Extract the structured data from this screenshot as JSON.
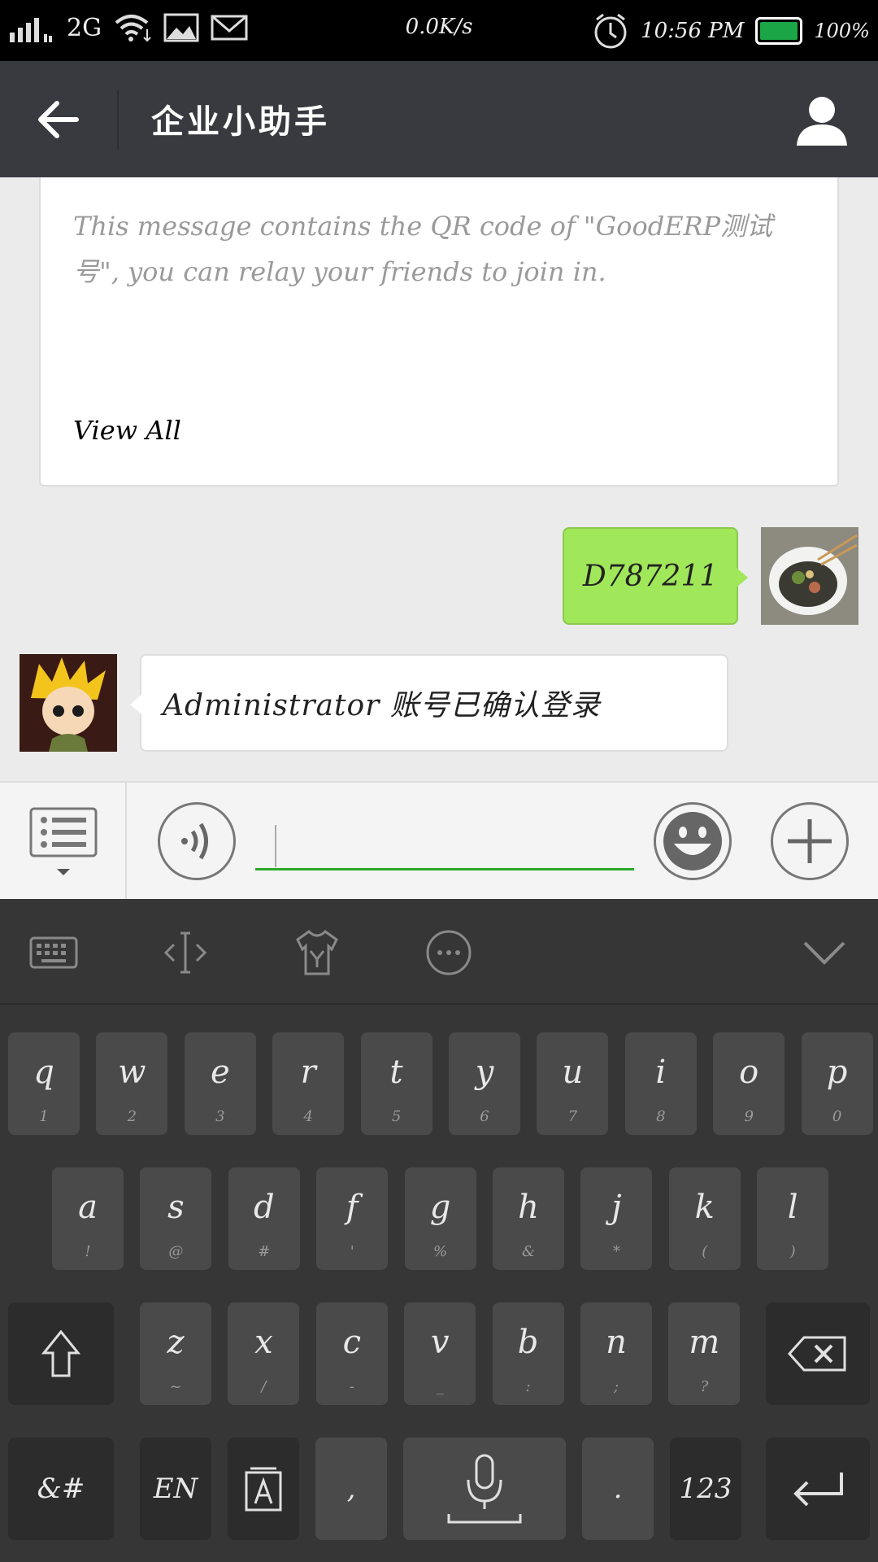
{
  "status_bar": {
    "network": "2G",
    "speed": "0.0K/s",
    "time": "10:56 PM",
    "battery": "100%",
    "battery_color": "#1aa547"
  },
  "header": {
    "title": "企业小助手",
    "back_icon": "arrow-left-icon",
    "profile_icon": "person-icon"
  },
  "messages": {
    "card": {
      "text": "This message contains the QR code of \"GoodERP测试号\", you can relay your friends to join in.",
      "link": "View All"
    },
    "outgoing": {
      "text": "D787211",
      "bubble_color": "#a0e75a"
    },
    "incoming": {
      "text": "Administrator 账号已确认登录"
    }
  },
  "input_bar": {
    "menu_icon": "list-menu-icon",
    "voice_icon": "voice-icon",
    "emoji_icon": "smiley-icon",
    "plus_icon": "plus-icon",
    "value": "",
    "accent": "#2ba82b"
  },
  "keyboard": {
    "toolbar": [
      "keyboard-icon",
      "cursor-move-icon",
      "theme-shirt-icon",
      "more-icon",
      "collapse-icon"
    ],
    "row1": [
      {
        "k": "q",
        "s": "1"
      },
      {
        "k": "w",
        "s": "2"
      },
      {
        "k": "e",
        "s": "3"
      },
      {
        "k": "r",
        "s": "4"
      },
      {
        "k": "t",
        "s": "5"
      },
      {
        "k": "y",
        "s": "6"
      },
      {
        "k": "u",
        "s": "7"
      },
      {
        "k": "i",
        "s": "8"
      },
      {
        "k": "o",
        "s": "9"
      },
      {
        "k": "p",
        "s": "0"
      }
    ],
    "row2": [
      {
        "k": "a",
        "s": "!"
      },
      {
        "k": "s",
        "s": "@"
      },
      {
        "k": "d",
        "s": "#"
      },
      {
        "k": "f",
        "s": "'"
      },
      {
        "k": "g",
        "s": "%"
      },
      {
        "k": "h",
        "s": "&"
      },
      {
        "k": "j",
        "s": "*"
      },
      {
        "k": "k",
        "s": "("
      },
      {
        "k": "l",
        "s": ")"
      }
    ],
    "row3": [
      {
        "k": "z",
        "s": "~"
      },
      {
        "k": "x",
        "s": "/"
      },
      {
        "k": "c",
        "s": "-"
      },
      {
        "k": "v",
        "s": "_"
      },
      {
        "k": "b",
        "s": ":"
      },
      {
        "k": "n",
        "s": ";"
      },
      {
        "k": "m",
        "s": "?"
      }
    ],
    "symbols": "&#",
    "lang": "EN",
    "comma": ",",
    "period": ".",
    "numbers": "123"
  }
}
